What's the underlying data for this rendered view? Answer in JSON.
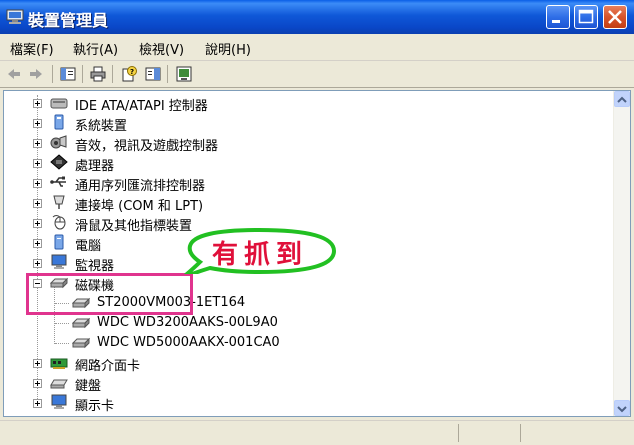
{
  "window": {
    "title": "裝置管理員",
    "icon": "device-manager-icon"
  },
  "menu": [
    {
      "label": "檔案(F)"
    },
    {
      "label": "執行(A)"
    },
    {
      "label": "檢視(V)"
    },
    {
      "label": "說明(H)"
    }
  ],
  "toolbar": {
    "icons": [
      "back-icon",
      "forward-icon",
      "properties-view-icon",
      "print-icon",
      "help-icon",
      "view-icon",
      "scan-hardware-icon"
    ]
  },
  "tree": {
    "items": [
      {
        "label": "IDE ATA/ATAPI 控制器",
        "icon": "ide-controller-icon",
        "expanded": false
      },
      {
        "label": "系統裝置",
        "icon": "system-device-icon",
        "expanded": false
      },
      {
        "label": "音效，視訊及遊戲控制器",
        "icon": "sound-video-icon",
        "expanded": false
      },
      {
        "label": "處理器",
        "icon": "processor-icon",
        "expanded": false
      },
      {
        "label": "通用序列匯流排控制器",
        "icon": "usb-icon",
        "expanded": false
      },
      {
        "label": "連接埠 (COM 和 LPT)",
        "icon": "port-icon",
        "expanded": false
      },
      {
        "label": "滑鼠及其他指標裝置",
        "icon": "mouse-icon",
        "expanded": false
      },
      {
        "label": "電腦",
        "icon": "computer-icon",
        "expanded": false
      },
      {
        "label": "監視器",
        "icon": "monitor-icon",
        "expanded": false
      },
      {
        "label": "磁碟機",
        "icon": "disk-drive-icon",
        "expanded": true,
        "children": [
          {
            "label": "ST2000VM003-1ET164",
            "icon": "disk-icon"
          },
          {
            "label": "WDC WD3200AAKS-00L9A0",
            "icon": "disk-icon"
          },
          {
            "label": "WDC WD5000AAKX-001CA0",
            "icon": "disk-icon"
          }
        ]
      },
      {
        "label": "網路介面卡",
        "icon": "network-adapter-icon",
        "expanded": false
      },
      {
        "label": "鍵盤",
        "icon": "keyboard-icon",
        "expanded": false
      },
      {
        "label": "顯示卡",
        "icon": "display-adapter-icon",
        "expanded": false
      }
    ]
  },
  "annotation": {
    "bubble_text": "有抓到",
    "highlight_color": "#e0348e",
    "bubble_border_color": "#22c022",
    "text_color": "#e0103a"
  },
  "colors": {
    "titlebar": "#0a47c8",
    "window_bg": "#ece9d8"
  }
}
